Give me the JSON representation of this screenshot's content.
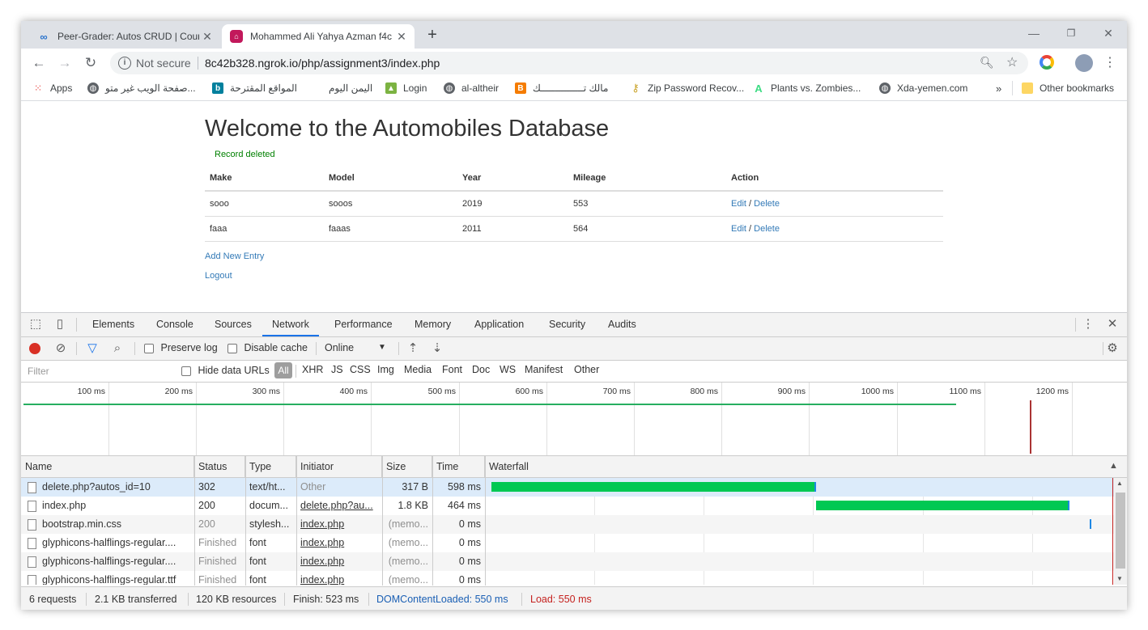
{
  "browser": {
    "tabs": [
      {
        "title": "Peer-Grader: Autos CRUD | Cours",
        "favicon": "coursera-icon",
        "color": "#2a73cc"
      },
      {
        "title": "Mohammed Ali Yahya Azman f4c",
        "favicon": "web-app-icon",
        "color": "#c2185b"
      }
    ],
    "address": {
      "security_label": "Not secure",
      "url": "8c42b328.ngrok.io/php/assignment3/index.php"
    },
    "bookmarks": {
      "apps": "Apps",
      "b1": "صفحة الويب غير متو...",
      "b2": "المواقع المقترحة",
      "b3": "اليمن اليوم",
      "b4": "Login",
      "b5": "al-altheir",
      "b6": "مالك تـــــــــــــــك",
      "b7": "Zip Password Recov...",
      "b8": "Plants vs. Zombies...",
      "b9": "Xda-yemen.com",
      "more": "»",
      "other": "Other bookmarks"
    }
  },
  "page": {
    "heading": "Welcome to the Automobiles Database",
    "flash": "Record deleted",
    "columns": {
      "make": "Make",
      "model": "Model",
      "year": "Year",
      "mileage": "Mileage",
      "action": "Action"
    },
    "rows": [
      {
        "make": "sooo",
        "model": "sooos",
        "year": "2019",
        "mileage": "553",
        "edit": "Edit",
        "sep": " / ",
        "delete": "Delete"
      },
      {
        "make": "faaa",
        "model": "faaas",
        "year": "2011",
        "mileage": "564",
        "edit": "Edit",
        "sep": " / ",
        "delete": "Delete"
      }
    ],
    "add_link": "Add New Entry",
    "logout_link": "Logout"
  },
  "devtools": {
    "tabs": [
      "Elements",
      "Console",
      "Sources",
      "Network",
      "Performance",
      "Memory",
      "Application",
      "Security",
      "Audits"
    ],
    "selected_tab": "Network",
    "toolbar": {
      "preserve_log": "Preserve log",
      "disable_cache": "Disable cache",
      "throttle": "Online"
    },
    "filter": {
      "placeholder": "Filter",
      "hide_data_urls": "Hide data URLs",
      "types": [
        "All",
        "XHR",
        "JS",
        "CSS",
        "Img",
        "Media",
        "Font",
        "Doc",
        "WS",
        "Manifest",
        "Other"
      ]
    },
    "timeline_ticks": [
      "100 ms",
      "200 ms",
      "300 ms",
      "400 ms",
      "500 ms",
      "600 ms",
      "700 ms",
      "800 ms",
      "900 ms",
      "1000 ms",
      "1100 ms",
      "1200 ms"
    ],
    "columns": {
      "name": "Name",
      "status": "Status",
      "type": "Type",
      "initiator": "Initiator",
      "size": "Size",
      "time": "Time",
      "waterfall": "Waterfall",
      "sort_arrow": "▲"
    },
    "requests": [
      {
        "name": "delete.php?autos_id=10",
        "status": "302",
        "type": "text/ht...",
        "initiator": "Other",
        "size": "317 B",
        "time": "598 ms"
      },
      {
        "name": "index.php",
        "status": "200",
        "type": "docum...",
        "initiator": "delete.php?au...",
        "size": "1.8 KB",
        "time": "464 ms"
      },
      {
        "name": "bootstrap.min.css",
        "status": "200",
        "type": "stylesh...",
        "initiator": "index.php",
        "size": "(memo...",
        "time": "0 ms"
      },
      {
        "name": "glyphicons-halflings-regular....",
        "status": "Finished",
        "type": "font",
        "initiator": "index.php",
        "size": "(memo...",
        "time": "0 ms"
      },
      {
        "name": "glyphicons-halflings-regular....",
        "status": "Finished",
        "type": "font",
        "initiator": "index.php",
        "size": "(memo...",
        "time": "0 ms"
      },
      {
        "name": "glyphicons-halflings-regular.ttf",
        "status": "Finished",
        "type": "font",
        "initiator": "index.php",
        "size": "(memo...",
        "time": "0 ms"
      }
    ],
    "summary": {
      "requests": "6 requests",
      "transferred": "2.1 KB transferred",
      "resources": "120 KB resources",
      "finish": "Finish: 523 ms",
      "dcl": "DOMContentLoaded: 550 ms",
      "load": "Load: 550 ms"
    },
    "colors": {
      "dcl": "#1a5fb4",
      "load": "#c5221f",
      "bar_green": "#00c853",
      "bar_blue": "#1e88e5"
    }
  }
}
